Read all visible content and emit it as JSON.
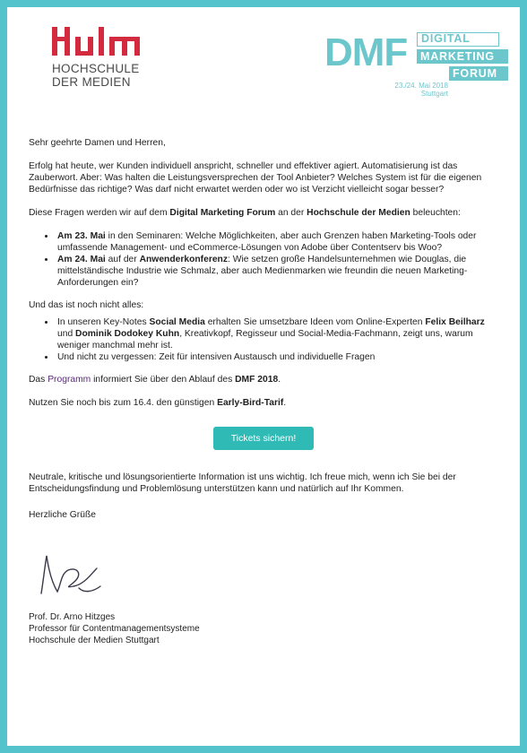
{
  "header": {
    "hdm_logo_text": [
      "HOCHSCHULE",
      "DER MEDIEN"
    ],
    "dmf_logo": {
      "big": "DMF",
      "words": [
        "DIGITAL",
        "MARKETING",
        "FORUM"
      ],
      "date": "23./24. Mai 2018",
      "city": "Stuttgart"
    },
    "colors": {
      "hdm_red": "#d42a3f",
      "dmf_teal": "#6cc7cd",
      "cta_teal": "#2fbab5",
      "frame": "#55c3cc"
    }
  },
  "letter": {
    "greeting": "Sehr geehrte Damen und Herren,",
    "intro": "Erfolg hat heute, wer Kunden individuell anspricht, schneller und effektiver agiert. Automatisierung ist das Zauberwort. Aber: Was halten die Leistungsversprechen der Tool Anbieter? Welches System ist für die eigenen Bedürfnisse das richtige? Was darf nicht erwartet werden oder wo ist Verzicht vielleicht sogar besser?",
    "questions_pre": "Diese Fragen werden wir auf dem ",
    "questions_bold": "Digital Marketing Forum",
    "questions_mid": " an der ",
    "questions_bold2": "Hochschule der Medien",
    "questions_post": " beleuchten:",
    "bullets1": [
      {
        "bold": "Am 23. Mai",
        "text": " in den Seminaren: Welche Möglichkeiten, aber auch Grenzen haben Marketing-Tools oder umfassende Management- und eCommerce-Lösungen von Adobe über Contentserv bis Woo?"
      },
      {
        "bold": "Am 24. Mai",
        "text": " auf der ",
        "bold2": "Anwenderkonferenz",
        "text2": ": Wie setzen große Handelsunternehmen wie Douglas, die mittelständische Industrie wie Schmalz, aber auch Medienmarken wie freundin die neuen Marketing-Anforderungen ein?"
      }
    ],
    "more": "Und das ist noch nicht alles:",
    "bullets2": [
      {
        "pre": "In unseren Key-Notes ",
        "bold": "Social Media",
        "text": " erhalten Sie umsetzbare Ideen vom Online-Experten ",
        "bold2": "Felix Beilharz",
        "text2": " und ",
        "bold3": "Dominik Dodokey Kuhn",
        "text3": ", Kreativkopf, Regisseur und Social-Media-Fachmann, zeigt uns, warum weniger manchmal mehr ist."
      },
      {
        "text": "Und nicht zu vergessen: Zeit für intensiven Austausch und individuelle Fragen"
      }
    ],
    "program_pre": "Das ",
    "program_link": "Programm",
    "program_mid": " informiert Sie über den Ablauf des ",
    "program_bold": "DMF 2018",
    "program_post": ".",
    "earlybird_pre": "Nutzen Sie noch bis zum 16.4. den günstigen ",
    "earlybird_bold": "Early-Bird-Tarif",
    "earlybird_post": ".",
    "cta_label": "Tickets sichern!",
    "closing_text": "Neutrale, kritische und lösungsorientierte Information ist uns wichtig. Ich freue mich, wenn ich Sie bei der Entscheidungsfindung und Problemlösung unterstützen kann und natürlich auf Ihr Kommen.",
    "regards": "Herzliche Grüße",
    "signer": [
      "Prof. Dr. Arno Hitzges",
      "Professor für Contentmanagementsysteme",
      "Hochschule der Medien Stuttgart"
    ]
  }
}
